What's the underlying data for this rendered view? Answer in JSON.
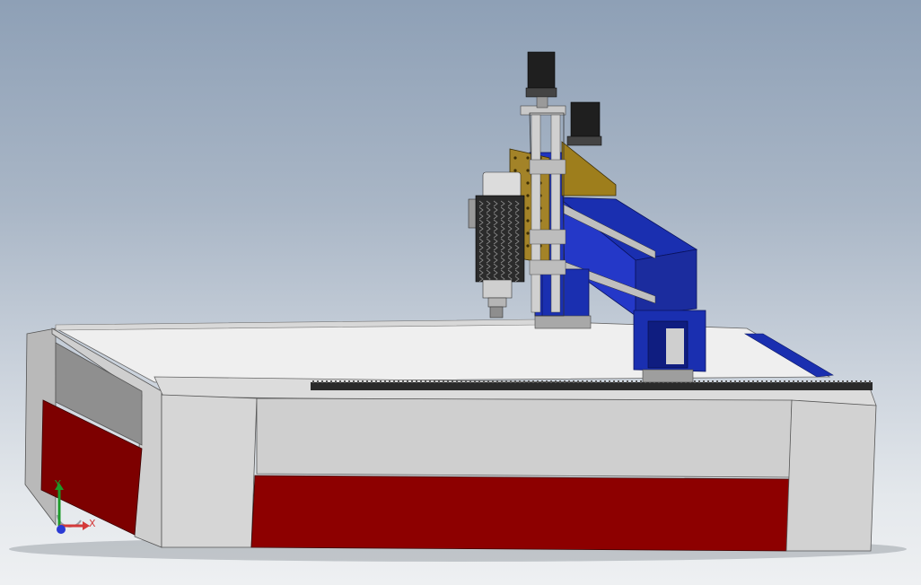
{
  "viewport": {
    "background_top": "#8ea0b6",
    "background_bottom": "#eef0f2"
  },
  "model": {
    "colors": {
      "bed_body": "#d4d4d4",
      "bed_top": "#efefef",
      "panel_red": "#8b0000",
      "gantry_blue": "#1a2fb0",
      "plate_gold": "#a08020",
      "motor_black": "#1f1f1f",
      "rack": "#2a2a2a"
    },
    "icons": [
      "cnc-router-model",
      "spindle-motor",
      "stepper-motor",
      "gear-rack"
    ]
  },
  "triad": {
    "x_label": "X",
    "y_label": "Y",
    "colors": {
      "x": "#d43a3a",
      "y": "#1d9a2a",
      "z": "#2a3ad4"
    }
  }
}
